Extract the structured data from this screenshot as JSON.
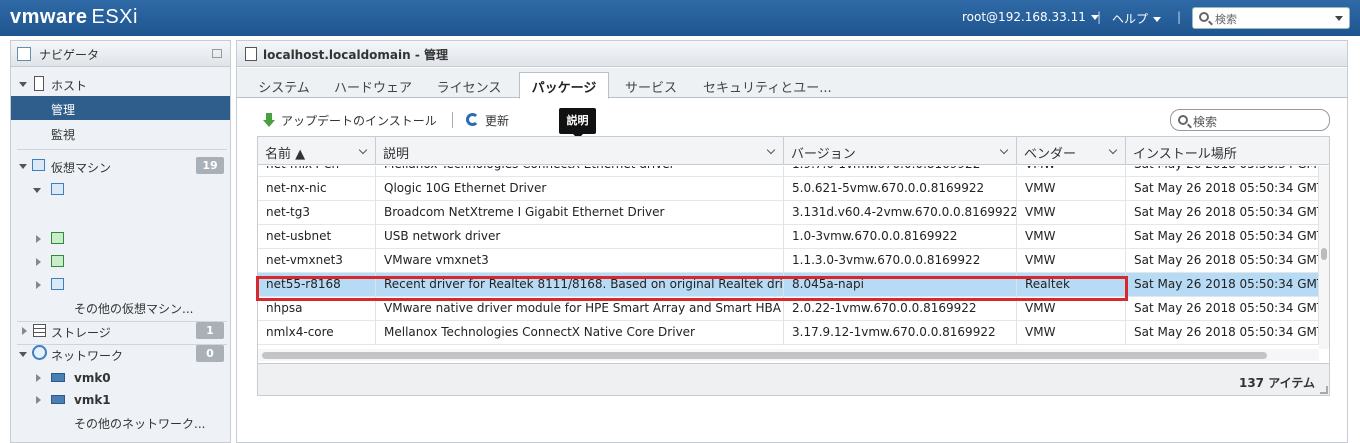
{
  "topbar": {
    "brand": "vmware",
    "product": "ESXi",
    "user": "root@192.168.33.11",
    "help": "ヘルプ",
    "search_placeholder": "検索"
  },
  "navigator": {
    "title": "ナビゲータ",
    "host": "ホスト",
    "manage": "管理",
    "monitor": "監視",
    "vms": "仮想マシン",
    "vms_count": "19",
    "vms_more": "その他の仮想マシン...",
    "storage": "ストレージ",
    "storage_count": "1",
    "network": "ネットワーク",
    "network_count": "0",
    "vmk0": "vmk0",
    "vmk1": "vmk1",
    "network_more": "その他のネットワーク..."
  },
  "main": {
    "title": "localhost.localdomain - 管理",
    "tabs": [
      "システム",
      "ハードウェア",
      "ライセンス",
      "パッケージ",
      "サービス",
      "セキュリティとユー..."
    ],
    "active_tab": "パッケージ",
    "toolbar": {
      "install_update": "アップデートのインストール",
      "refresh": "更新"
    },
    "tooltip": "説明",
    "grid_search_placeholder": "検索"
  },
  "grid": {
    "columns": [
      "名前 ▲",
      "説明",
      "バージョン",
      "ベンダー",
      "インストール場所"
    ],
    "rows": [
      [
        "net-mlx4-en",
        "Mellanox Technologies ConnectX Ethernet driver",
        "1.9.7.0-1vmw.670.0.0.8169922",
        "VMW",
        "Sat May 26 2018 05:50:34 GMT+0"
      ],
      [
        "net-nx-nic",
        "Qlogic 10G Ethernet Driver",
        "5.0.621-5vmw.670.0.0.8169922",
        "VMW",
        "Sat May 26 2018 05:50:34 GMT+0"
      ],
      [
        "net-tg3",
        "Broadcom NetXtreme I Gigabit Ethernet Driver",
        "3.131d.v60.4-2vmw.670.0.0.8169922",
        "VMW",
        "Sat May 26 2018 05:50:34 GMT+0"
      ],
      [
        "net-usbnet",
        "USB network driver",
        "1.0-3vmw.670.0.0.8169922",
        "VMW",
        "Sat May 26 2018 05:50:34 GMT+0"
      ],
      [
        "net-vmxnet3",
        "VMware vmxnet3",
        "1.1.3.0-3vmw.670.0.0.8169922",
        "VMW",
        "Sat May 26 2018 05:50:34 GMT+0"
      ],
      [
        "net55-r8168",
        "Recent driver for Realtek 8111/8168. Based on original Realtek drivers",
        "8.045a-napi",
        "Realtek",
        "Sat May 26 2018 05:50:34 GMT+0"
      ],
      [
        "nhpsa",
        "VMware native driver module for HPE Smart Array and Smart HBA cont...",
        "2.0.22-1vmw.670.0.0.8169922",
        "VMW",
        "Sat May 26 2018 05:50:34 GMT+0"
      ],
      [
        "nmlx4-core",
        "Mellanox Technologies ConnectX Native Core Driver",
        "3.17.9.12-1vmw.670.0.0.8169922",
        "VMW",
        "Sat May 26 2018 05:50:34 GMT+0"
      ]
    ],
    "selected_row": "net55-r8168",
    "item_count": "137 アイテム"
  }
}
